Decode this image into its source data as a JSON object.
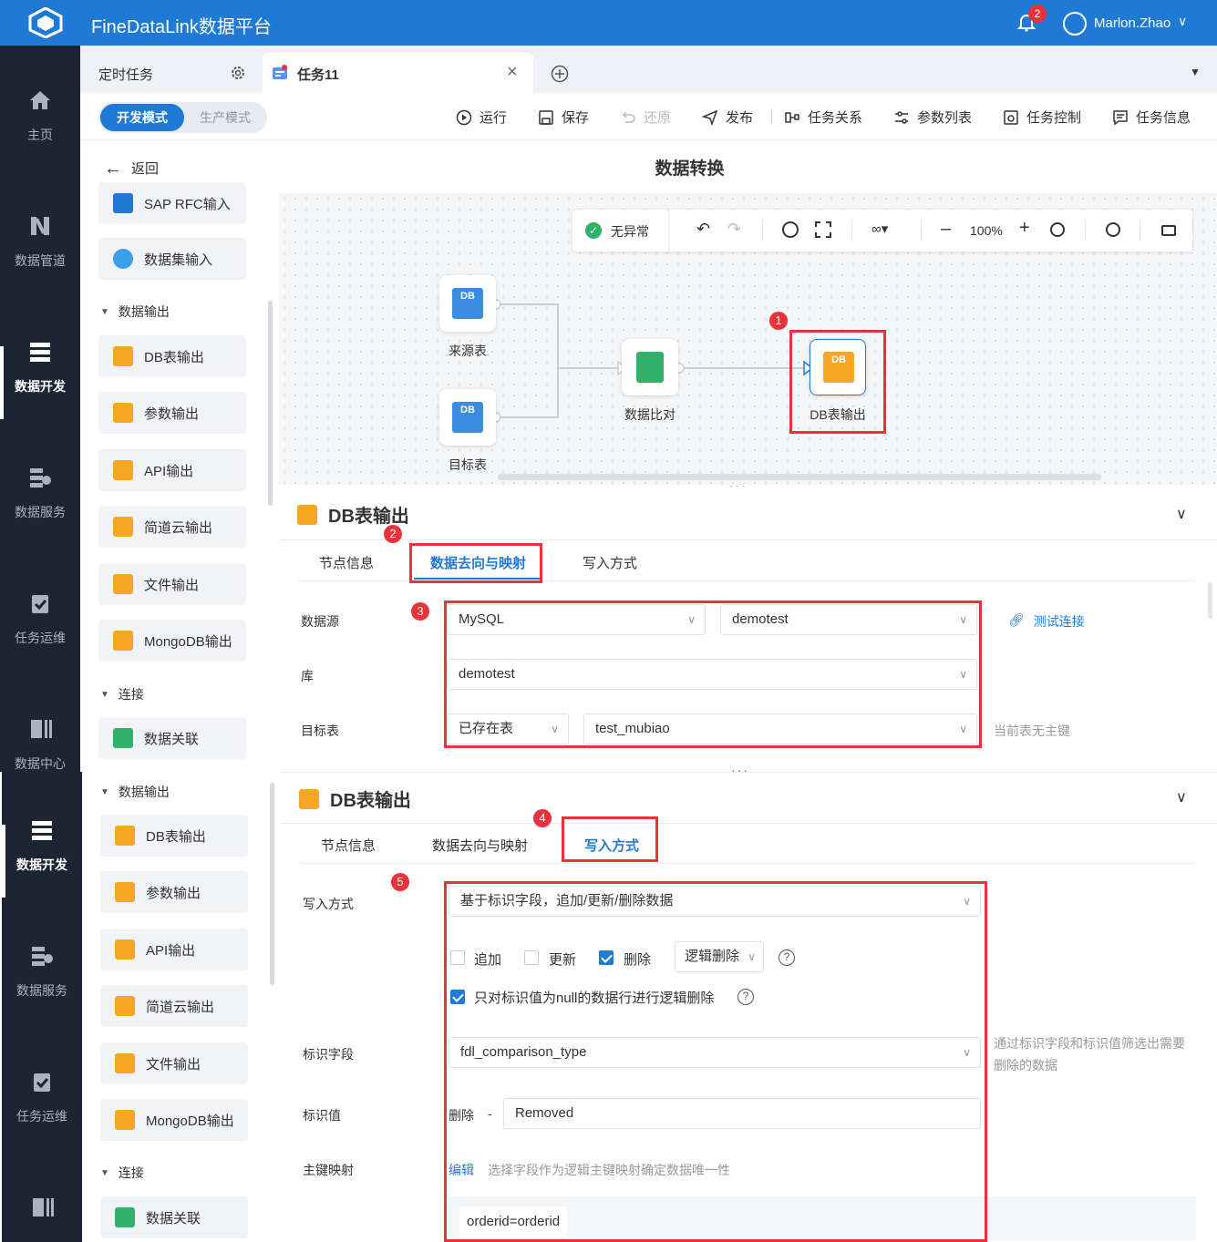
{
  "app": {
    "title": "FineDataLink数据平台",
    "notifications": "2",
    "user": "Marlon.Zhao"
  },
  "nav": {
    "top": [
      {
        "label": "主页"
      },
      {
        "label": "数据管道"
      },
      {
        "label": "数据开发"
      },
      {
        "label": "数据服务"
      },
      {
        "label": "任务运维"
      },
      {
        "label": "数据中心"
      }
    ],
    "bottom": [
      {
        "label": "数据开发"
      },
      {
        "label": "数据服务"
      },
      {
        "label": "任务运维"
      }
    ]
  },
  "tabs": {
    "scheduled": "定时任务",
    "task": "任务11"
  },
  "modes": {
    "dev": "开发模式",
    "prod": "生产模式"
  },
  "toolbar": {
    "run": "运行",
    "save": "保存",
    "restore": "还原",
    "publish": "发布",
    "relations": "任务关系",
    "params": "参数列表",
    "control": "任务控制",
    "info": "任务信息"
  },
  "subhead": {
    "back": "返回",
    "title": "数据转换"
  },
  "palette_top": {
    "items1": [
      "SAP RFC输入",
      "数据集输入"
    ],
    "group_out": "数据输出",
    "outputs": [
      "DB表输出",
      "参数输出",
      "API输出",
      "简道云输出",
      "文件输出",
      "MongoDB输出"
    ],
    "group_join": "连接",
    "joins": [
      "数据关联"
    ]
  },
  "palette_bottom": {
    "group_out": "数据输出",
    "outputs": [
      "DB表输出",
      "参数输出",
      "API输出",
      "简道云输出",
      "文件输出",
      "MongoDB输出"
    ],
    "group_join": "连接",
    "joins": [
      "数据关联"
    ]
  },
  "canvas": {
    "status": "无异常",
    "zoom": "100%",
    "nodes": {
      "source": "来源表",
      "target": "目标表",
      "compare": "数据比对",
      "output": "DB表输出"
    }
  },
  "markers": [
    "1",
    "2",
    "3",
    "4",
    "5"
  ],
  "panel1": {
    "title": "DB表输出",
    "tabs": [
      "节点信息",
      "数据去向与映射",
      "写入方式"
    ],
    "labels": {
      "datasource": "数据源",
      "db": "库",
      "table": "目标表"
    },
    "datasource_type": "MySQL",
    "datasource_conn": "demotest",
    "test_conn": "测试连接",
    "database": "demotest",
    "table_mode": "已存在表",
    "table_name": "test_mubiao",
    "table_hint": "当前表无主键"
  },
  "panel2": {
    "title": "DB表输出",
    "tabs": [
      "节点信息",
      "数据去向与映射",
      "写入方式"
    ],
    "labels": {
      "write_mode": "写入方式",
      "flag_field": "标识字段",
      "flag_value": "标识值",
      "pk_map": "主键映射"
    },
    "write_mode": "基于标识字段，追加/更新/删除数据",
    "opts": {
      "append": "追加",
      "update": "更新",
      "delete": "删除",
      "delete_mode": "逻辑删除"
    },
    "null_only": "只对标识值为null的数据行进行逻辑删除",
    "flag_field": "fdl_comparison_type",
    "flag_hint": "通过标识字段和标识值筛选出需要删除的数据",
    "flag_value_prefix": "删除",
    "flag_value_sep": "-",
    "flag_value": "Removed",
    "pk_edit": "编辑",
    "pk_hint": "选择字段作为逻辑主键映射确定数据唯一性",
    "pk_value": "orderid=orderid"
  },
  "colors": {
    "brand": "#1f7ad6",
    "nav": "#1b2533",
    "marker": "#e8323c"
  }
}
